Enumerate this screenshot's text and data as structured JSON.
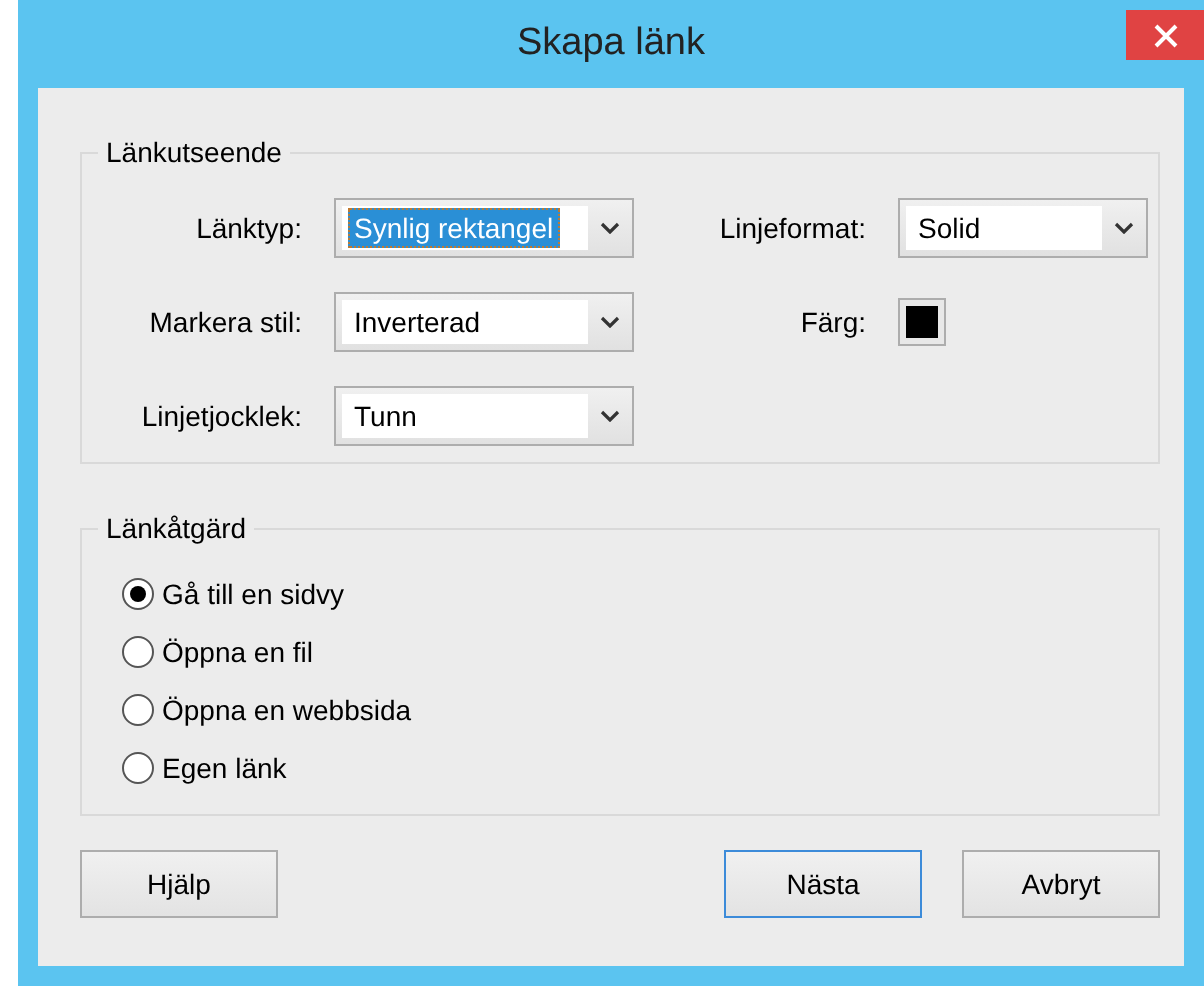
{
  "window": {
    "title": "Skapa länk"
  },
  "appearance": {
    "legend": "Länkutseende",
    "fields": [
      {
        "kind": "dropdown",
        "label": "Länktyp:",
        "value": "Synlig rektangel",
        "focused": true
      },
      {
        "kind": "dropdown",
        "label": "Linjeformat:",
        "value": "Solid",
        "focused": false
      },
      {
        "kind": "dropdown",
        "label": "Markera stil:",
        "value": "Inverterad",
        "focused": false
      },
      {
        "kind": "color",
        "label": "Färg:",
        "color": "#000000"
      },
      {
        "kind": "dropdown",
        "label": "Linjetjocklek:",
        "value": "Tunn",
        "focused": false
      }
    ]
  },
  "action": {
    "legend": "Länkåtgärd",
    "options": [
      {
        "label": "Gå till en sidvy",
        "selected": true
      },
      {
        "label": "Öppna en fil",
        "selected": false
      },
      {
        "label": "Öppna en webbsida",
        "selected": false
      },
      {
        "label": "Egen länk",
        "selected": false
      }
    ]
  },
  "buttons": [
    {
      "label": "Hjälp",
      "default": false
    },
    {
      "label": "Nästa",
      "default": true
    },
    {
      "label": "Avbryt",
      "default": false
    }
  ]
}
